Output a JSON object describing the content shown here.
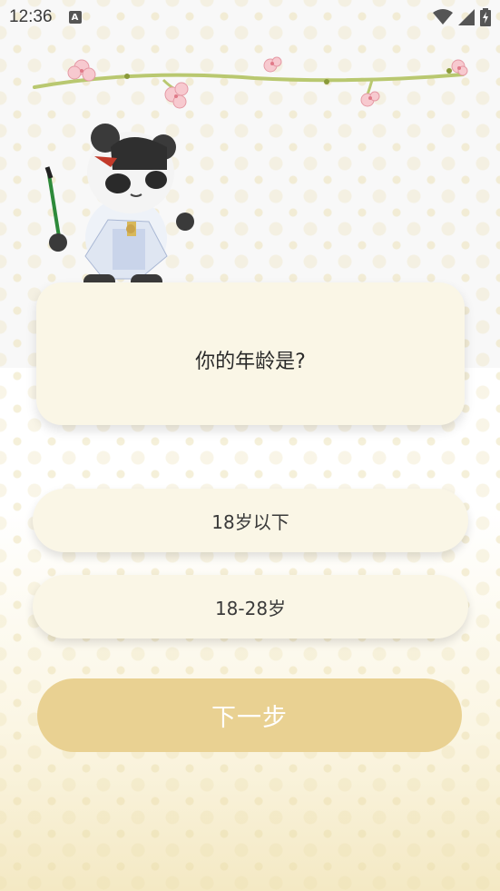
{
  "status_bar": {
    "time": "12:36",
    "notification_icon": "A",
    "icons": [
      "wifi-icon",
      "signal-icon",
      "battery-charging-icon"
    ]
  },
  "question": {
    "text": "你的年龄是?"
  },
  "options": [
    {
      "label": "18岁以下"
    },
    {
      "label": "18-28岁"
    }
  ],
  "next_button": {
    "label": "下一步",
    "color": "#e9d192"
  },
  "colors": {
    "card": "#faf6e6",
    "accent": "#e9d192"
  }
}
